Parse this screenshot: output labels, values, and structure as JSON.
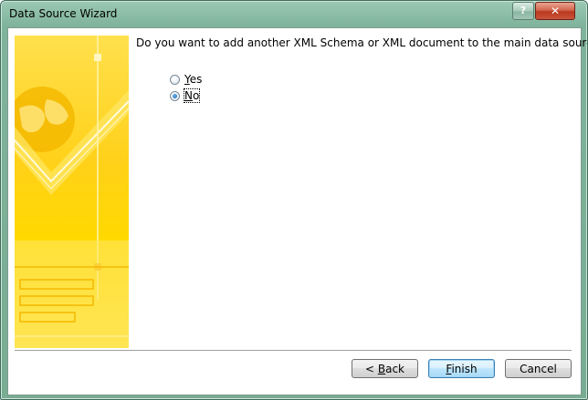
{
  "window": {
    "title": "Data Source Wizard",
    "help_label": "?",
    "close_label": "✕"
  },
  "main": {
    "question": "Do you want to add another XML Schema or XML document to the main data source?",
    "options": [
      {
        "label_access": "Y",
        "label_rest": "es",
        "checked": false
      },
      {
        "label_access": "N",
        "label_rest": "o",
        "checked": true
      }
    ]
  },
  "buttons": {
    "back_prefix": "< ",
    "back_access": "B",
    "back_rest": "ack",
    "finish_access": "F",
    "finish_rest": "inish",
    "cancel": "Cancel"
  },
  "colors": {
    "banner_yellow": "#ffd700",
    "title_bar": "#8fbfa9"
  }
}
